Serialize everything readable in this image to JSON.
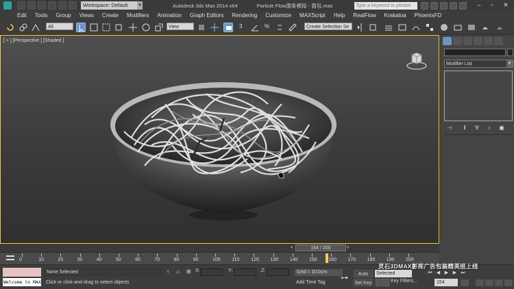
{
  "titlebar": {
    "workspace": "Workspace: Default",
    "app_title": "Autodesk 3ds Max  2014 x64",
    "doc_title": "Particle Flow面条模拟 - 面包.max",
    "help_search_placeholder": "Type a keyword or phrase"
  },
  "menu": [
    "Edit",
    "Tools",
    "Group",
    "Views",
    "Create",
    "Modifiers",
    "Animation",
    "Graph Editors",
    "Rendering",
    "Customize",
    "MAXScript",
    "Help",
    "RealFlow",
    "Krakatoa",
    "PhoenixFD"
  ],
  "toolbar": {
    "selection_filter": "All",
    "ref_coord": "View",
    "snap_label": "3",
    "named_selection": "Create Selection Se"
  },
  "viewport": {
    "label": "[ + ] [Perspective ] [Shaded ]"
  },
  "command_panel": {
    "modifier_list": "Modifier List"
  },
  "timeslider": {
    "frame": "154 / 200",
    "left_arrow": "<",
    "right_arrow": ">"
  },
  "track": {
    "ticks": [
      "0",
      "10",
      "20",
      "30",
      "40",
      "50",
      "60",
      "70",
      "80",
      "90",
      "100",
      "110",
      "120",
      "130",
      "140",
      "150",
      "160",
      "170",
      "180",
      "190",
      "200"
    ]
  },
  "status": {
    "maxscript_line": "Welcome to MAX!",
    "selection": "None Selected",
    "prompt": "Click or click-and-drag to select objects",
    "x_label": "X:",
    "y_label": "Y:",
    "z_label": "Z:",
    "grid": "Grid = 10.0cm",
    "add_time_tag": "Add Time Tag",
    "auto_key": "Auto Key",
    "set_key": "Set Key",
    "selected": "Selected",
    "key_filters": "Key Filters...",
    "current_frame": "154"
  },
  "watermark": "灵石3DMAX影视广告包装精英班上线"
}
